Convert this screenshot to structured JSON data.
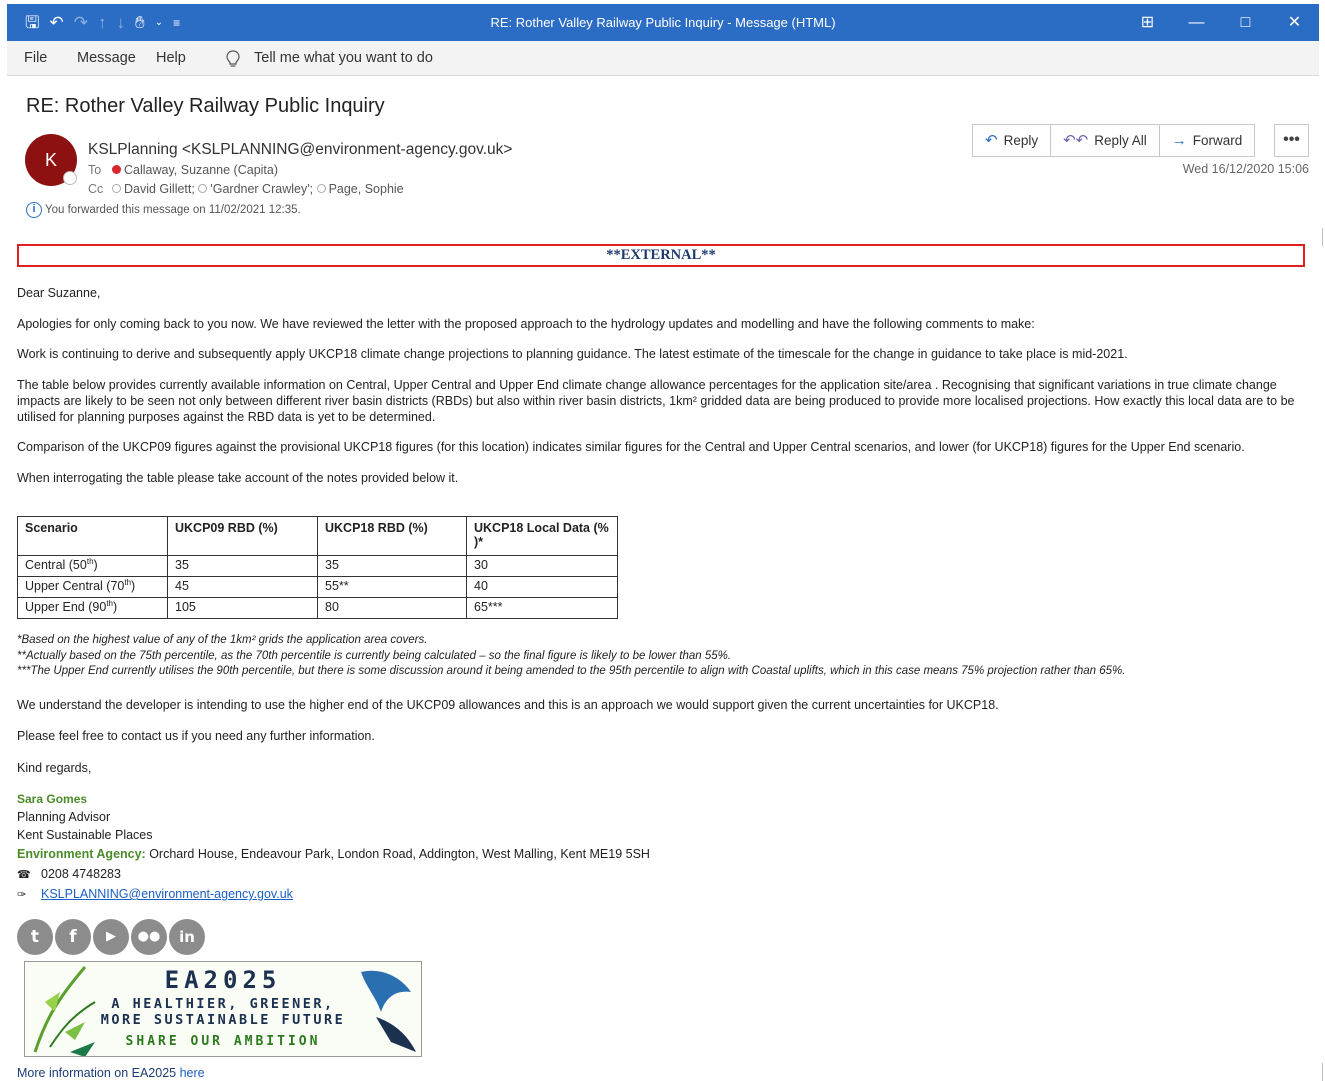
{
  "window": {
    "title": "RE: Rother Valley Railway Public Inquiry  -  Message (HTML)",
    "controls": [
      "ribbon-display-icon",
      "minimize-icon",
      "maximize-icon",
      "close-icon"
    ]
  },
  "menu": {
    "file": "File",
    "message": "Message",
    "help": "Help",
    "tell_me": "Tell me what you want to do"
  },
  "header": {
    "subject": "RE: Rother Valley Railway Public Inquiry",
    "avatar_initial": "K",
    "from": "KSLPlanning <KSLPLANNING@environment-agency.gov.uk>",
    "to_label": "To",
    "to": "Callaway, Suzanne (Capita)",
    "cc_label": "Cc",
    "cc": [
      "David Gillett;",
      "'Gardner Crawley';",
      "Page, Sophie"
    ],
    "forward_info": "You forwarded this message on 11/02/2021 12:35.",
    "date": "Wed 16/12/2020 15:06",
    "actions": {
      "reply": "Reply",
      "reply_all": "Reply All",
      "forward": "Forward",
      "more": "•••"
    }
  },
  "body": {
    "external": "**EXTERNAL**",
    "greeting": "Dear Suzanne,",
    "p1": "Apologies for only coming back to you now. We have reviewed the letter with the proposed approach to the hydrology updates and modelling and have the following comments to make:",
    "p2": "Work is continuing to derive and subsequently apply UKCP18 climate change projections to planning guidance. The latest estimate of the timescale for the change in guidance to take place is mid-2021.",
    "p3": "The table below provides currently available information on Central, Upper Central and Upper End climate change allowance percentages for the application site/area . Recognising that significant variations in true climate change impacts are likely to be seen not only between different river basin districts (RBDs) but also within river basin districts, 1km² gridded data are being produced to provide more localised projections. How exactly this local data are to be utilised for planning purposes against the RBD data is yet to be determined.",
    "p4": "Comparison of the UKCP09 figures against the provisional UKCP18 figures (for this location) indicates similar figures for the Central and Upper Central scenarios, and lower (for UKCP18) figures for the Upper End scenario.",
    "p5": "When interrogating the table please take account of the notes provided below it.",
    "table": {
      "headers": [
        "Scenario",
        "UKCP09 RBD (%)",
        "UKCP18 RBD (%)",
        "UKCP18 Local Data (% )*"
      ],
      "rows": [
        {
          "scenario": "Central (50",
          "sup": "th",
          "close": ")",
          "ukcp09": "35",
          "ukcp18": "35",
          "local": "30"
        },
        {
          "scenario": "Upper Central (70",
          "sup": "th",
          "close": ")",
          "ukcp09": "45",
          "ukcp18": "55**",
          "local": "40"
        },
        {
          "scenario": "Upper End (90",
          "sup": "th",
          "close": ")",
          "ukcp09": "105",
          "ukcp18": "80",
          "local": "65***"
        }
      ]
    },
    "notes": [
      "*Based on the highest value of any of the 1km² grids the application area covers.",
      "**Actually based on the 75th percentile, as the 70th percentile is currently being calculated – so the final figure is likely to be lower than 55%.",
      "***The Upper End currently utilises the 90th percentile, but there is some discussion around it being amended to the 95th percentile to align with Coastal uplifts, which in this case means 75% projection rather than 65%."
    ],
    "p6": "We understand the developer is intending to use the higher end of the UKCP09 allowances and this is an approach we would support given the current uncertainties for UKCP18.",
    "p7": "Please feel free to contact us if you need any further information.",
    "closing": "Kind regards,"
  },
  "signature": {
    "name": "Sara Gomes",
    "role": "Planning Advisor",
    "team": "Kent Sustainable Places",
    "org_label": "Environment Agency:",
    "address": " Orchard House, Endeavour Park, London Road, Addington, West Malling, Kent ME19 5SH",
    "phone": "0208 4748283",
    "email": "KSLPLANNING@environment-agency.gov.uk",
    "social": [
      "twitter-icon",
      "facebook-icon",
      "youtube-icon",
      "flickr-icon",
      "linkedin-icon"
    ],
    "banner": {
      "title": "EA2025",
      "line1": "A HEALTHIER, GREENER,",
      "line2": "MORE SUSTAINABLE FUTURE",
      "line3": "SHARE OUR AMBITION"
    },
    "more_info": "More information on EA2025 ",
    "more_info_link": "here"
  }
}
